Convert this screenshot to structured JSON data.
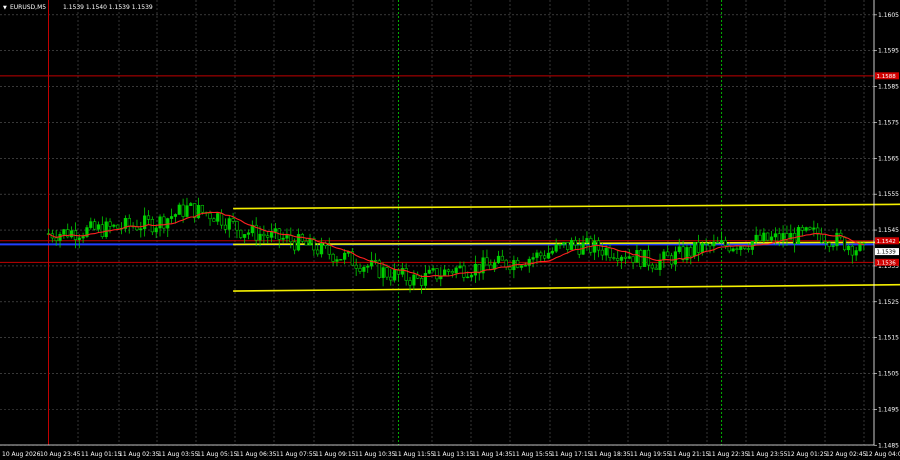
{
  "header": {
    "symbol": "EURUSD,M5",
    "ohlc": "1.1539 1.1540 1.1539 1.1539"
  },
  "colors": {
    "background": "#000000",
    "grid": "#5a5a5a",
    "candle": "#00d000",
    "ma": "#ff2020",
    "channel": "#f5f000",
    "level_red": "#c00000",
    "level_blue": "#2040ff",
    "session_line": "#00b000",
    "tag_red": "#d00000",
    "tag_bid": "#ffffff",
    "axis": "#ffffff"
  },
  "chart_data": {
    "type": "candlestick",
    "ylim": [
      1.1483,
      1.1612
    ],
    "y_ticks": [
      "1.1605",
      "1.1595",
      "1.1585",
      "1.1575",
      "1.1565",
      "1.1555",
      "1.1545",
      "1.1535",
      "1.1525",
      "1.1515",
      "1.1505",
      "1.1495",
      "1.1485"
    ],
    "x_labels": [
      "10 Aug 2026",
      "10 Aug 23:45",
      "11 Aug 01:15",
      "11 Aug 02:35",
      "11 Aug 03:55",
      "11 Aug 05:15",
      "11 Aug 06:35",
      "11 Aug 07:55",
      "11 Aug 09:15",
      "11 Aug 10:35",
      "11 Aug 11:55",
      "11 Aug 13:15",
      "11 Aug 14:35",
      "11 Aug 15:55",
      "11 Aug 17:15",
      "11 Aug 18:35",
      "11 Aug 19:55",
      "11 Aug 21:15",
      "11 Aug 22:35",
      "11 Aug 23:55",
      "12 Aug 01:25",
      "12 Aug 02:45",
      "12 Aug 04:05"
    ],
    "series": [
      {
        "name": "EURUSD,M5",
        "kind": "candles",
        "x_start": "10 Aug 23:25",
        "bar_minutes": 5,
        "count": 213,
        "key_closes": [
          [
            0,
            1.1544
          ],
          [
            12,
            1.1545
          ],
          [
            28,
            1.1547
          ],
          [
            36,
            1.1551
          ],
          [
            44,
            1.1549
          ],
          [
            50,
            1.1545
          ],
          [
            63,
            1.1542
          ],
          [
            78,
            1.1537
          ],
          [
            88,
            1.1533
          ],
          [
            96,
            1.1531
          ],
          [
            105,
            1.1534
          ],
          [
            115,
            1.1535
          ],
          [
            128,
            1.1538
          ],
          [
            136,
            1.1541
          ],
          [
            148,
            1.1539
          ],
          [
            158,
            1.1536
          ],
          [
            170,
            1.154
          ],
          [
            185,
            1.1542
          ],
          [
            200,
            1.1544
          ],
          [
            208,
            1.1541
          ],
          [
            212,
            1.1539
          ]
        ]
      },
      {
        "name": "ma",
        "kind": "line"
      },
      {
        "name": "channel",
        "kind": "channel",
        "x_start": "11 Aug 03:25",
        "x_end": "12 Aug 04:05",
        "upper": [
          1.1551,
          1.1553
        ],
        "middle": [
          1.1541,
          1.1542
        ],
        "lower": [
          1.1528,
          1.1531
        ],
        "inner_upper_end": 1.1547,
        "inner_lower_end": 1.1536
      }
    ],
    "levels": [
      {
        "value": 1.1588,
        "color": "red"
      },
      {
        "value": 1.1536,
        "color": "red"
      },
      {
        "value": 1.1542,
        "color": "red"
      },
      {
        "value": 1.1541,
        "color": "blue"
      }
    ],
    "vlines": [
      {
        "x": "10 Aug 23:25",
        "color": "red",
        "style": "solid"
      },
      {
        "x": "11 Aug 07:00",
        "color": "green",
        "style": "dotted"
      },
      {
        "x": "11 Aug 14:00",
        "color": "green",
        "style": "dotted"
      },
      {
        "x": "11 Aug 23:25",
        "color": "red",
        "style": "solid"
      }
    ],
    "tags": [
      {
        "value": 1.1588,
        "label": "1.1588",
        "color": "red"
      },
      {
        "value": 1.1542,
        "label": "1.1542",
        "color": "red"
      },
      {
        "value": 1.1539,
        "label": "1.1539",
        "color": "bid"
      },
      {
        "value": 1.1536,
        "label": "1.1536",
        "color": "red"
      }
    ]
  }
}
